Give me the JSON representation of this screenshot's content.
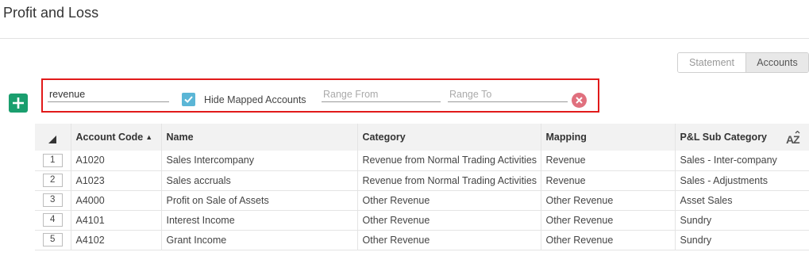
{
  "page": {
    "title": "Profit and Loss"
  },
  "view_toggle": {
    "statement_label": "Statement",
    "accounts_label": "Accounts",
    "active": "Accounts"
  },
  "filter": {
    "search_value": "revenue",
    "hide_mapped_label": "Hide Mapped Accounts",
    "hide_mapped_checked": true,
    "range_from_placeholder": "Range From",
    "range_to_placeholder": "Range To"
  },
  "table": {
    "columns": {
      "account_code": "Account Code",
      "name": "Name",
      "category": "Category",
      "mapping": "Mapping",
      "sub_category": "P&L Sub Category"
    },
    "rows": [
      {
        "num": "1",
        "code": "A1020",
        "name": "Sales Intercompany",
        "category": "Revenue from Normal Trading Activities",
        "mapping": "Revenue",
        "sub": "Sales - Inter-company"
      },
      {
        "num": "2",
        "code": "A1023",
        "name": "Sales accruals",
        "category": "Revenue from Normal Trading Activities",
        "mapping": "Revenue",
        "sub": "Sales - Adjustments"
      },
      {
        "num": "3",
        "code": "A4000",
        "name": "Profit on Sale of Assets",
        "category": "Other Revenue",
        "mapping": "Other Revenue",
        "sub": "Asset Sales"
      },
      {
        "num": "4",
        "code": "A4101",
        "name": "Interest Income",
        "category": "Other Revenue",
        "mapping": "Other Revenue",
        "sub": "Sundry"
      },
      {
        "num": "5",
        "code": "A4102",
        "name": "Grant Income",
        "category": "Other Revenue",
        "mapping": "Other Revenue",
        "sub": "Sundry"
      }
    ]
  },
  "colors": {
    "accent_green": "#1a9e6e",
    "checkbox_blue": "#5bb6d6",
    "highlight_red": "#e11a1a",
    "clear_pink": "#e0707e"
  }
}
